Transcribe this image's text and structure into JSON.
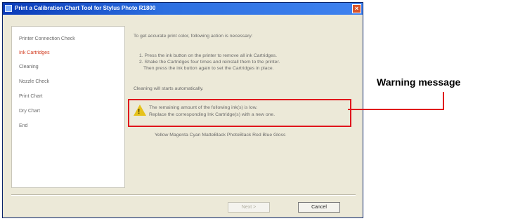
{
  "window": {
    "title": "Print a Calibration Chart Tool for Stylus Photo R1800",
    "close_symbol": "×"
  },
  "sidebar": {
    "items": [
      {
        "label": "Printer Connection Check",
        "active": false
      },
      {
        "label": "Ink Cartridges",
        "active": true
      },
      {
        "label": "Cleaning",
        "active": false
      },
      {
        "label": "Nozzle Check",
        "active": false
      },
      {
        "label": "Print Chart",
        "active": false
      },
      {
        "label": "Dry Chart",
        "active": false
      },
      {
        "label": "End",
        "active": false
      }
    ]
  },
  "content": {
    "intro": "To get accurate print color, following action is necessary:",
    "instruction_1": "1. Press the ink button on the printer to remove all ink Cartridges.",
    "instruction_2": "2. Shake the Cartridges four times and reinstall them to the printer.",
    "instruction_3": "Then press the ink button again to set the Cartridges in place.",
    "cleaning_note": "Cleaning will starts automatically.",
    "warning_line_1": "The remaining amount of the following ink(s) is low.",
    "warning_line_2": "Replace the corresponding Ink Cartridge(s) with a new one.",
    "cartridges": "Yellow Magenta Cyan MatteBlack PhotoBlack Red Blue Gloss",
    "warning_icon_name": "warning-icon"
  },
  "buttons": {
    "next": "Next >",
    "cancel": "Cancel"
  },
  "callout": {
    "label": "Warning message",
    "color": "#e0141c"
  }
}
